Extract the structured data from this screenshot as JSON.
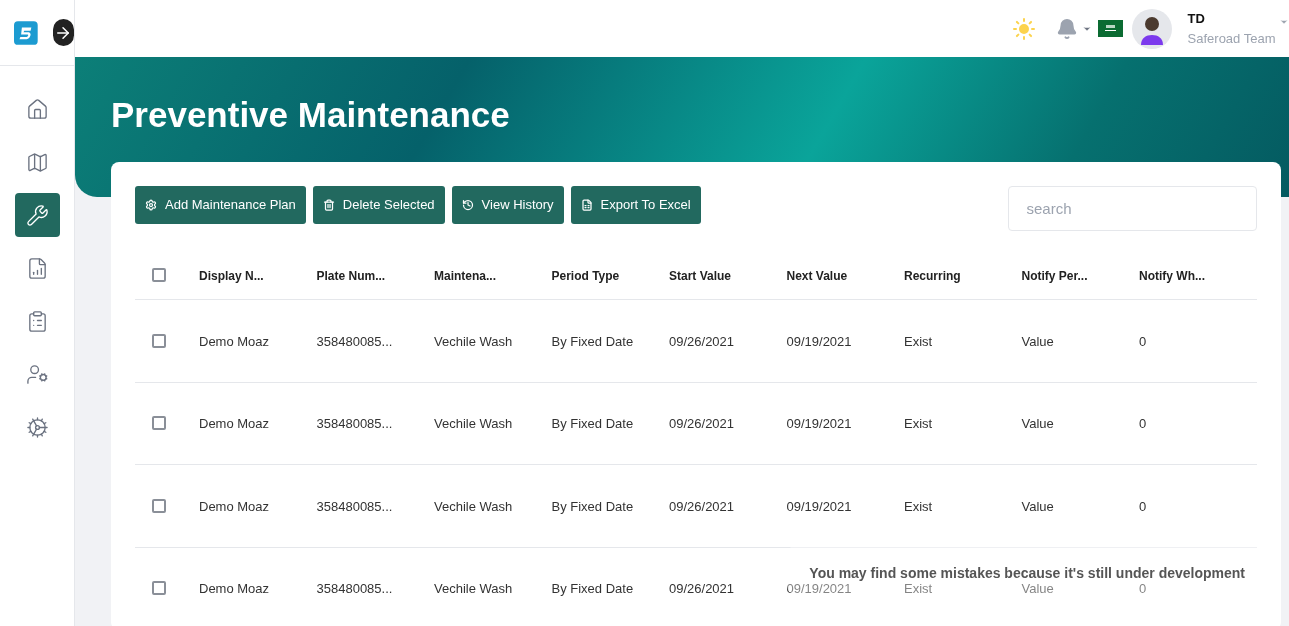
{
  "sidebar": {
    "items": [
      {
        "selected": false
      },
      {
        "selected": false
      },
      {
        "selected": true
      },
      {
        "selected": false
      },
      {
        "selected": false
      },
      {
        "selected": false
      },
      {
        "selected": false
      }
    ]
  },
  "header": {
    "user": {
      "initials": "TD",
      "team": "Saferoad Team"
    }
  },
  "page": {
    "title": "Preventive Maintenance"
  },
  "toolbar": {
    "buttons": [
      {
        "kind": "gear",
        "label": "Add Maintenance Plan"
      },
      {
        "kind": "trash",
        "label": "Delete Selected"
      },
      {
        "kind": "history",
        "label": "View History"
      },
      {
        "kind": "excel",
        "label": "Export To Excel"
      }
    ],
    "search": {
      "placeholder": "search"
    }
  },
  "table": {
    "header_checked": false,
    "columns": [
      "Display N...",
      "Plate Num...",
      "Maintena...",
      "Period Type",
      "Start Value",
      "Next Value",
      "Recurring",
      "Notify Per...",
      "Notify Wh..."
    ],
    "rows": [
      {
        "checked": false,
        "cells": [
          "Demo Moaz",
          "358480085...",
          "Vechile Wash",
          "By Fixed Date",
          "09/26/2021",
          "09/19/2021",
          "Exist",
          "Value",
          "0"
        ]
      },
      {
        "checked": false,
        "cells": [
          "Demo Moaz",
          "358480085...",
          "Vechile Wash",
          "By Fixed Date",
          "09/26/2021",
          "09/19/2021",
          "Exist",
          "Value",
          "0"
        ]
      },
      {
        "checked": false,
        "cells": [
          "Demo Moaz",
          "358480085...",
          "Vechile Wash",
          "By Fixed Date",
          "09/26/2021",
          "09/19/2021",
          "Exist",
          "Value",
          "0"
        ]
      },
      {
        "checked": false,
        "cells": [
          "Demo Moaz",
          "358480085...",
          "Vechile Wash",
          "By Fixed Date",
          "09/26/2021",
          "09/19/2021",
          "Exist",
          "Value",
          "0"
        ]
      }
    ]
  },
  "toast": {
    "message": "You may find some mistakes because it's still under development"
  }
}
